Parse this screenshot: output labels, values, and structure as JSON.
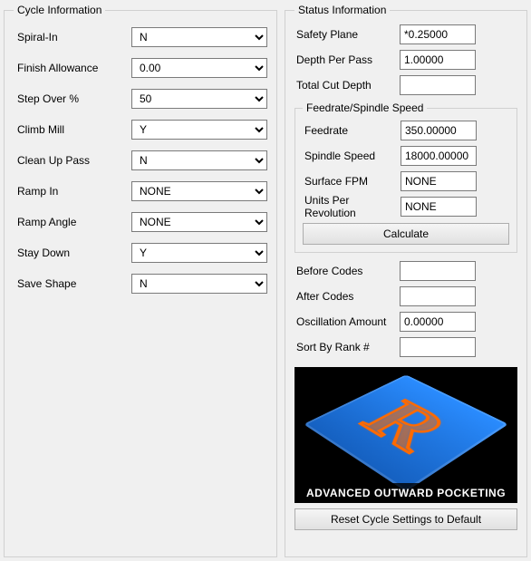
{
  "cycle": {
    "legend": "Cycle Information",
    "spiral_in": {
      "label": "Spiral-In",
      "value": "N"
    },
    "finish_allowance": {
      "label": "Finish Allowance",
      "value": "0.00"
    },
    "step_over": {
      "label": "Step Over %",
      "value": "50"
    },
    "climb_mill": {
      "label": "Climb Mill",
      "value": "Y"
    },
    "clean_up_pass": {
      "label": "Clean Up Pass",
      "value": "N"
    },
    "ramp_in": {
      "label": "Ramp In",
      "value": "NONE"
    },
    "ramp_angle": {
      "label": "Ramp Angle",
      "value": "NONE"
    },
    "stay_down": {
      "label": "Stay Down",
      "value": "Y"
    },
    "save_shape": {
      "label": "Save Shape",
      "value": "N"
    }
  },
  "status": {
    "legend": "Status Information",
    "safety_plane": {
      "label": "Safety Plane",
      "value": "*0.25000"
    },
    "depth_per_pass": {
      "label": "Depth Per Pass",
      "value": "1.00000"
    },
    "total_cut_depth": {
      "label": "Total Cut Depth",
      "value": ""
    },
    "feedrate_group": {
      "legend": "Feedrate/Spindle Speed",
      "feedrate": {
        "label": "Feedrate",
        "value": "350.00000"
      },
      "spindle_speed": {
        "label": "Spindle Speed",
        "value": "18000.00000"
      },
      "surface_fpm": {
        "label": "Surface FPM",
        "value": "NONE"
      },
      "units_per_rev": {
        "label": "Units Per Revolution",
        "value": "NONE"
      },
      "calculate_label": "Calculate"
    },
    "before_codes": {
      "label": "Before Codes",
      "value": ""
    },
    "after_codes": {
      "label": "After Codes",
      "value": ""
    },
    "oscillation_amount": {
      "label": "Oscillation Amount",
      "value": "0.00000"
    },
    "sort_by_rank": {
      "label": "Sort By Rank #",
      "value": ""
    },
    "image_caption": "ADVANCED OUTWARD POCKETING",
    "reset_label": "Reset Cycle Settings to Default"
  }
}
